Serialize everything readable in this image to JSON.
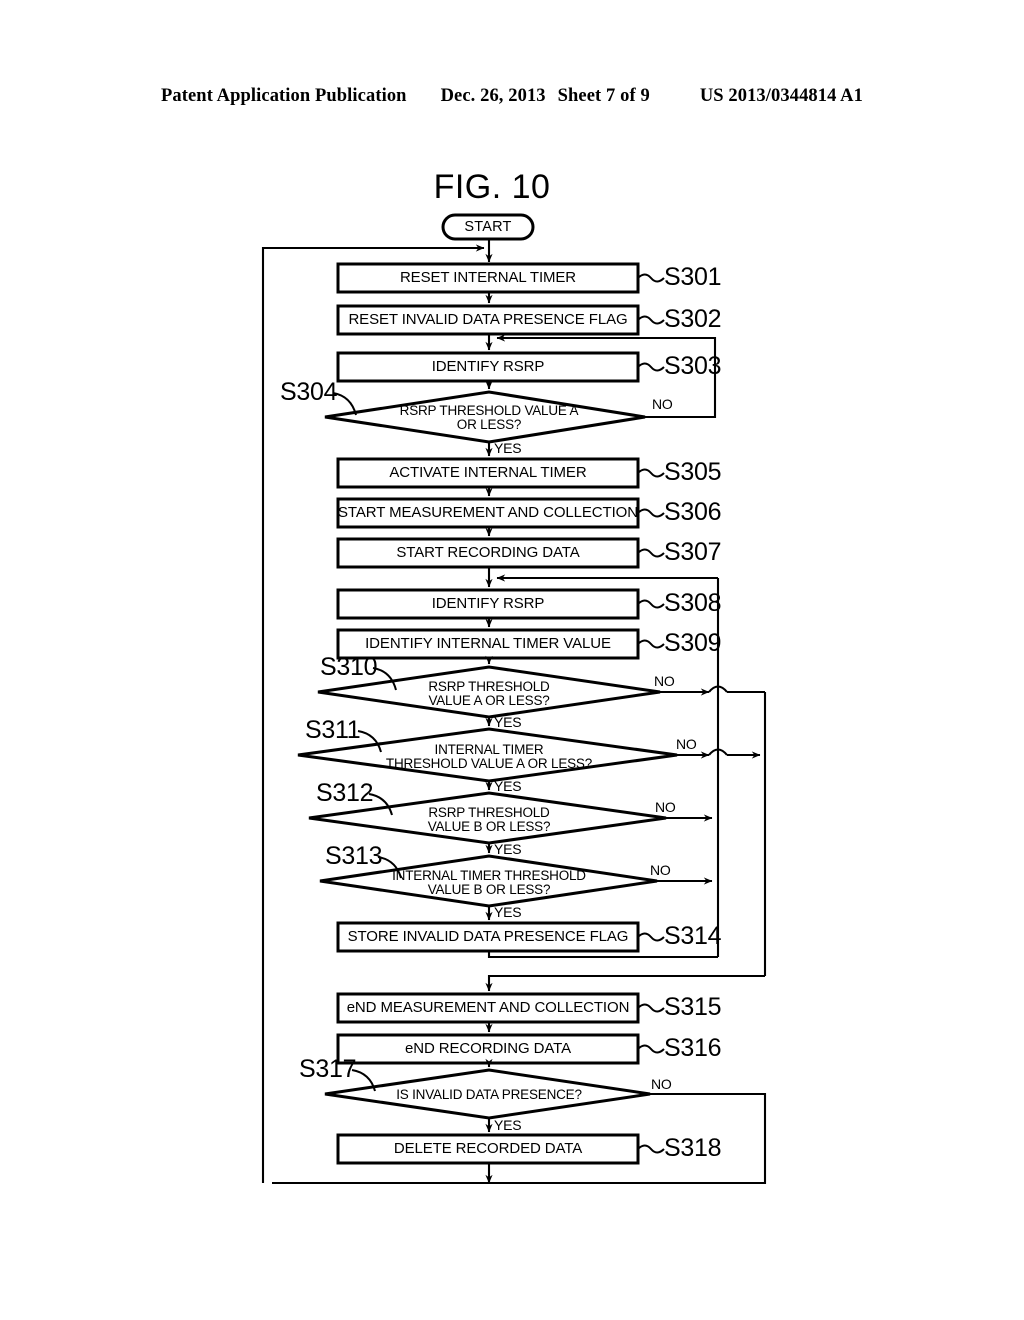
{
  "header": {
    "publication": "Patent Application Publication",
    "date": "Dec. 26, 2013",
    "sheet": "Sheet 7 of 9",
    "number": "US 2013/0344814 A1"
  },
  "figure": {
    "title": "FIG. 10"
  },
  "flowchart": {
    "terminal": {
      "label": "START"
    },
    "nodes": [
      {
        "id": "S301",
        "ref": "S301",
        "type": "process",
        "label": "RESET INTERNAL TIMER"
      },
      {
        "id": "S302",
        "ref": "S302",
        "type": "process",
        "label": "RESET INVALID DATA PRESENCE FLAG"
      },
      {
        "id": "S303",
        "ref": "S303",
        "type": "process",
        "label": "IDENTIFY RSRP"
      },
      {
        "id": "S304",
        "ref": "S304",
        "type": "decision",
        "label": "RSRP THRESHOLD VALUE A\nOR LESS?"
      },
      {
        "id": "S305",
        "ref": "S305",
        "type": "process",
        "label": "ACTIVATE INTERNAL TIMER"
      },
      {
        "id": "S306",
        "ref": "S306",
        "type": "process",
        "label": "START MEASUREMENT AND COLLECTION"
      },
      {
        "id": "S307",
        "ref": "S307",
        "type": "process",
        "label": "START RECORDING DATA"
      },
      {
        "id": "S308",
        "ref": "S308",
        "type": "process",
        "label": "IDENTIFY RSRP"
      },
      {
        "id": "S309",
        "ref": "S309",
        "type": "process",
        "label": "IDENTIFY INTERNAL TIMER VALUE"
      },
      {
        "id": "S310",
        "ref": "S310",
        "type": "decision",
        "label": "RSRP THRESHOLD\nVALUE A OR LESS?"
      },
      {
        "id": "S311",
        "ref": "S311",
        "type": "decision",
        "label": "INTERNAL TIMER\nTHRESHOLD VALUE A OR LESS?"
      },
      {
        "id": "S312",
        "ref": "S312",
        "type": "decision",
        "label": "RSRP THRESHOLD\nVALUE B OR LESS?"
      },
      {
        "id": "S313",
        "ref": "S313",
        "type": "decision",
        "label": "INTERNAL TIMER THRESHOLD\nVALUE B OR LESS?"
      },
      {
        "id": "S314",
        "ref": "S314",
        "type": "process",
        "label": "STORE INVALID DATA PRESENCE FLAG"
      },
      {
        "id": "S315",
        "ref": "S315",
        "type": "process",
        "label": "eND MEASUREMENT AND COLLECTION"
      },
      {
        "id": "S316",
        "ref": "S316",
        "type": "process",
        "label": "eND RECORDING DATA"
      },
      {
        "id": "S317",
        "ref": "S317",
        "type": "decision",
        "label": "IS INVALID DATA PRESENCE?"
      },
      {
        "id": "S318",
        "ref": "S318",
        "type": "process",
        "label": "DELETE RECORDED DATA"
      }
    ],
    "branches": {
      "yes": "YES",
      "no": "NO"
    },
    "branch_labels": [
      {
        "id": "s304-no",
        "text": "NO"
      },
      {
        "id": "s304-yes",
        "text": "YES"
      },
      {
        "id": "s310-no",
        "text": "NO"
      },
      {
        "id": "s310-yes",
        "text": "YES"
      },
      {
        "id": "s311-no",
        "text": "NO"
      },
      {
        "id": "s311-yes",
        "text": "YES"
      },
      {
        "id": "s312-no",
        "text": "NO"
      },
      {
        "id": "s312-yes",
        "text": "YES"
      },
      {
        "id": "s313-no",
        "text": "NO"
      },
      {
        "id": "s313-yes",
        "text": "YES"
      },
      {
        "id": "s317-no",
        "text": "NO"
      },
      {
        "id": "s317-yes",
        "text": "YES"
      }
    ],
    "colors": {
      "line": "#000000",
      "background": "#ffffff"
    }
  }
}
